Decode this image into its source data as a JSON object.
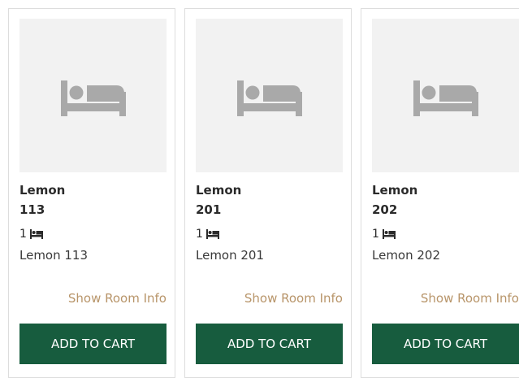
{
  "rooms": [
    {
      "name_line1": "Lemon",
      "name_line2": "113",
      "bed_count": "1",
      "description": "Lemon 113",
      "info_label": "Show Room Info",
      "cart_label": "ADD TO CART"
    },
    {
      "name_line1": "Lemon",
      "name_line2": "201",
      "bed_count": "1",
      "description": "Lemon 201",
      "info_label": "Show Room Info",
      "cart_label": "ADD TO CART"
    },
    {
      "name_line1": "Lemon",
      "name_line2": "202",
      "bed_count": "1",
      "description": "Lemon 202",
      "info_label": "Show Room Info",
      "cart_label": "ADD TO CART"
    }
  ],
  "icons": {
    "placeholder": "bed-icon",
    "bed_count": "bed-icon"
  },
  "colors": {
    "button_bg": "#175c3e",
    "link": "#b8956a",
    "thumb_bg": "#f2f2f2",
    "placeholder_icon": "#a9a9a9"
  }
}
